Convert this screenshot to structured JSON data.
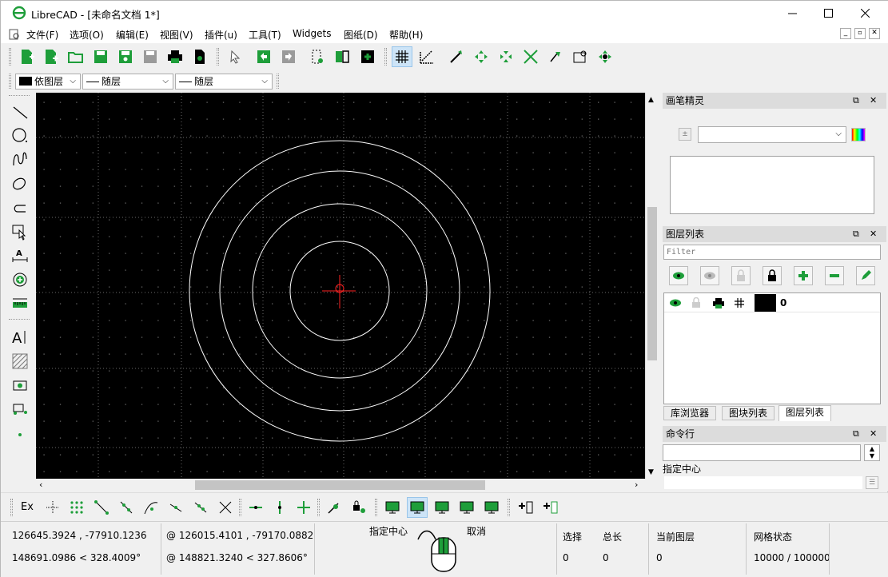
{
  "window": {
    "title": "LibreCAD - [未命名文档 1*]"
  },
  "menu": [
    "文件(F)",
    "选项(O)",
    "编辑(E)",
    "视图(V)",
    "插件(u)",
    "工具(T)",
    "Widgets",
    "图纸(D)",
    "帮助(H)"
  ],
  "attributes": {
    "color": "依图层",
    "line_type": "随层",
    "line_width": "随层"
  },
  "colors": {
    "canvas": "#000000",
    "circles": "#ffffff",
    "crosshair": "#ff0000",
    "accent": "#1e9e3a"
  },
  "dock": {
    "pen": {
      "title": "画笔精灵"
    },
    "layers": {
      "title": "图层列表",
      "filter_placeholder": "Filter",
      "layer_name": "0"
    },
    "tabs": [
      "库浏览器",
      "图块列表",
      "图层列表"
    ],
    "cmd": {
      "title": "命令行",
      "prompt": "指定中心"
    }
  },
  "snap": {
    "ex": "Ex"
  },
  "status": {
    "abs_coord": "126645.3924 , -77910.1236",
    "abs_polar": "148691.0986 < 328.4009°",
    "rel_coord": "@  126015.4101 , -79170.0882",
    "rel_polar": "@  148821.3240 < 327.8606°",
    "mouse_left": "指定中心",
    "mouse_right": "取消",
    "selected_label": "选择",
    "selected_value": "0",
    "length_label": "总长",
    "length_value": "0",
    "layer_label": "当前图层",
    "layer_value": "0",
    "grid_label": "网格状态",
    "grid_value": "10000 / 100000"
  }
}
